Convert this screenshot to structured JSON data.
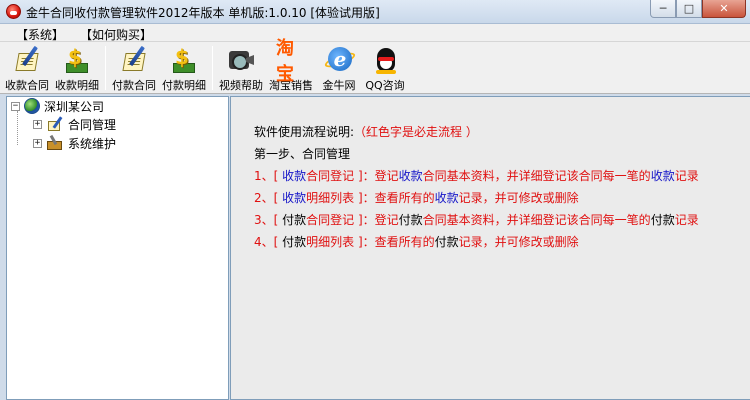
{
  "window": {
    "title": "金牛合同收付款管理软件2012年版本 单机版:1.0.10 [体验试用版]",
    "controls": {
      "minimize": "─",
      "maximize": "□",
      "close": "✕"
    }
  },
  "menu": {
    "items": [
      {
        "label": "【系统】"
      },
      {
        "label": "【如何购买】"
      }
    ]
  },
  "toolbar": {
    "buttons": [
      {
        "label": "收款合同",
        "icon": "contract-pen-icon"
      },
      {
        "label": "收款明细",
        "icon": "money-icon"
      },
      {
        "label": "付款合同",
        "icon": "contract-pen-icon"
      },
      {
        "label": "付款明细",
        "icon": "money-icon"
      },
      {
        "label": "视频帮助",
        "icon": "film-camera-icon"
      },
      {
        "label": "淘宝销售",
        "icon": "taobao-icon",
        "glyph": "淘宝"
      },
      {
        "label": "金牛网",
        "icon": "ie-icon",
        "glyph": "e"
      },
      {
        "label": "QQ咨询",
        "icon": "qq-icon"
      }
    ]
  },
  "tree": {
    "root": {
      "label": "深圳某公司",
      "expander": "⊟"
    },
    "children": [
      {
        "label": "合同管理",
        "expander": "+"
      },
      {
        "label": "系统维护",
        "expander": "+"
      }
    ]
  },
  "content": {
    "heading_prefix": "软件使用流程说明:",
    "heading_note": "（红色字是必走流程 ）",
    "step1": "第一步、合同管理",
    "steps": [
      {
        "num": "1、",
        "parts": [
          {
            "text": "[ ",
            "color": "red"
          },
          {
            "text": "收款",
            "color": "blue"
          },
          {
            "text": "合同登记 ]：登记",
            "color": "red"
          },
          {
            "text": "收款",
            "color": "blue"
          },
          {
            "text": "合同基本资料，并详细登记该合同每一笔的",
            "color": "red"
          },
          {
            "text": "收款",
            "color": "blue"
          },
          {
            "text": "记录",
            "color": "red"
          }
        ]
      },
      {
        "num": "2、",
        "parts": [
          {
            "text": "[ ",
            "color": "red"
          },
          {
            "text": "收款",
            "color": "blue"
          },
          {
            "text": "明细列表 ]：查看所有的",
            "color": "red"
          },
          {
            "text": "收款",
            "color": "blue"
          },
          {
            "text": "记录，并可修改或删除",
            "color": "red"
          }
        ]
      },
      {
        "num": "3、",
        "parts": [
          {
            "text": "[ ",
            "color": "red"
          },
          {
            "text": "付款",
            "color": "black"
          },
          {
            "text": "合同登记 ]：登记",
            "color": "red"
          },
          {
            "text": "付款",
            "color": "black"
          },
          {
            "text": "合同基本资料，并详细登记该合同每一笔的",
            "color": "red"
          },
          {
            "text": "付款",
            "color": "black"
          },
          {
            "text": "记录",
            "color": "red"
          }
        ]
      },
      {
        "num": "4、",
        "parts": [
          {
            "text": "[ ",
            "color": "red"
          },
          {
            "text": "付款",
            "color": "black"
          },
          {
            "text": "明细列表 ]：查看所有的",
            "color": "red"
          },
          {
            "text": "付款",
            "color": "black"
          },
          {
            "text": "记录，并可修改或删除",
            "color": "red"
          }
        ]
      }
    ]
  },
  "colors": {
    "red": "#e01010",
    "blue": "#1515c8",
    "black": "#000000"
  }
}
